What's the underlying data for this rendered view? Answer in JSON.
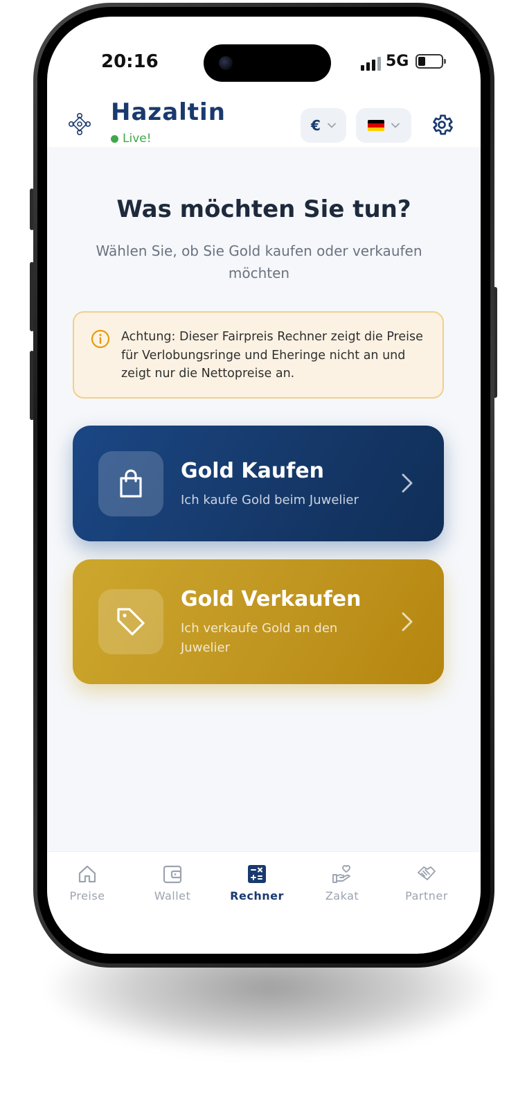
{
  "status_bar": {
    "time": "20:16",
    "network": "5G"
  },
  "header": {
    "brand": "Hazaltin",
    "live_label": "Live!",
    "currency_symbol": "€",
    "language_flag": "de",
    "icons": {
      "logo": "ornament-logo-icon",
      "settings": "gear-icon"
    }
  },
  "main": {
    "title": "Was möchten Sie tun?",
    "subtitle": "Wählen Sie, ob Sie Gold kaufen oder verkaufen möchten",
    "notice": {
      "icon": "info-icon",
      "text": "Achtung: Dieser Fairpreis Rechner zeigt die Preise für Verlobungsringe und Eheringe nicht an und zeigt nur die Nettopreise an."
    },
    "cards": [
      {
        "id": "buy",
        "title": "Gold Kaufen",
        "subtitle": "Ich kaufe Gold beim Juwelier",
        "icon": "shopping-bag-icon",
        "color": "#1b4785"
      },
      {
        "id": "sell",
        "title": "Gold Verkaufen",
        "subtitle": "Ich verkaufe Gold an den Juwelier",
        "icon": "price-tag-icon",
        "color": "#c8a02a"
      }
    ]
  },
  "bottom_nav": {
    "items": [
      {
        "label": "Preise",
        "icon": "home-icon",
        "active": false
      },
      {
        "label": "Wallet",
        "icon": "wallet-icon",
        "active": false
      },
      {
        "label": "Rechner",
        "icon": "calculator-icon",
        "active": true
      },
      {
        "label": "Zakat",
        "icon": "hand-heart-icon",
        "active": false
      },
      {
        "label": "Partner",
        "icon": "handshake-icon",
        "active": false
      }
    ]
  },
  "colors": {
    "brand_navy": "#1a3a6e",
    "live_green": "#3fa84a",
    "gold": "#c8a02a",
    "notice_bg": "#fcf2e3",
    "notice_border": "#f3cf88"
  }
}
